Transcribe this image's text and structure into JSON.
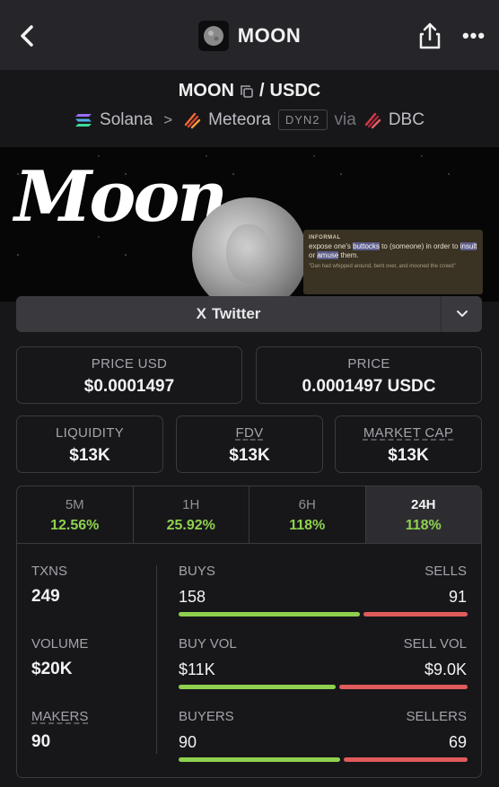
{
  "nav": {
    "title": "MOON",
    "back_icon": "chevron-left-icon",
    "share_icon": "share-icon",
    "more_label": "•••"
  },
  "pair": {
    "base": "MOON",
    "slash": "/",
    "quote": "USDC",
    "chain": "Solana",
    "arrow": ">",
    "dex": "Meteora",
    "dex_badge": "DYN2",
    "via": "via",
    "launchpad": "DBC"
  },
  "banner": {
    "word": "Moon",
    "definition_tag": "INFORMAL",
    "definition_text_a": "expose one's ",
    "definition_hl1": "buttocks",
    "definition_text_b": " to (someone) in order to ",
    "definition_hl2": "insult",
    "definition_text_c": " or ",
    "definition_hl3": "amuse",
    "definition_text_d": " them.",
    "definition_quote": "\"Dan had whipped around, bent over, and mooned the crowd\""
  },
  "twitter": {
    "label": "Twitter",
    "x_glyph": "X"
  },
  "prices": {
    "price_usd_label": "PRICE USD",
    "price_usd": "$0.0001497",
    "price_label": "PRICE",
    "price": "0.0001497 USDC"
  },
  "metrics": {
    "liquidity_label": "LIQUIDITY",
    "liquidity": "$13K",
    "fdv_label": "FDV",
    "fdv": "$13K",
    "mcap_label": "MARKET CAP",
    "mcap": "$13K"
  },
  "timeframes": [
    {
      "label": "5M",
      "value": "12.56%"
    },
    {
      "label": "1H",
      "value": "25.92%"
    },
    {
      "label": "6H",
      "value": "118%"
    },
    {
      "label": "24H",
      "value": "118%"
    }
  ],
  "active_timeframe": "24H",
  "stats": {
    "txns_label": "TXNS",
    "txns": "249",
    "buys_label": "BUYS",
    "buys": "158",
    "sells_label": "SELLS",
    "sells": "91",
    "buys_share": 0.635,
    "volume_label": "VOLUME",
    "volume": "$20K",
    "buy_vol_label": "BUY VOL",
    "buy_vol": "$11K",
    "sell_vol_label": "SELL VOL",
    "sell_vol": "$9.0K",
    "buy_vol_share": 0.55,
    "makers_label": "MAKERS",
    "makers": "90",
    "buyers_label": "BUYERS",
    "buyers": "90",
    "sellers_label": "SELLERS",
    "sellers": "69",
    "buyers_share": 0.566
  },
  "colors": {
    "positive": "#8fd14f",
    "negative": "#e05b5b",
    "background": "#17171a"
  }
}
